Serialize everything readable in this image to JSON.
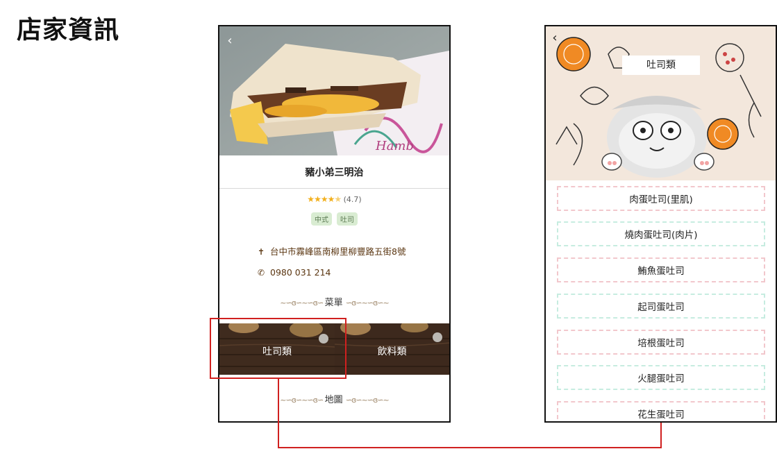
{
  "page": {
    "title": "店家資訊"
  },
  "shop_screen": {
    "back_icon": "chevron-left-icon",
    "shop_name": "豬小弟三明治",
    "rating": {
      "stars": 4.5,
      "max_stars": 5,
      "text": "(4.7)"
    },
    "tags": [
      "中式",
      "吐司"
    ],
    "address": "台中市霧峰區南柳里柳豐路五街8號",
    "address_icon": "signpost-icon",
    "phone": "0980 031 214",
    "phone_icon": "phone-icon",
    "menu_section": "菜單",
    "categories": [
      {
        "label": "吐司類"
      },
      {
        "label": "飲料類"
      }
    ],
    "map_section": "地圖"
  },
  "menu_screen": {
    "back_icon": "chevron-left-icon",
    "banner_title": "吐司類",
    "items": [
      {
        "label": "肉蛋吐司(里肌)"
      },
      {
        "label": "燒肉蛋吐司(肉片)"
      },
      {
        "label": "鮪魚蛋吐司"
      },
      {
        "label": "起司蛋吐司"
      },
      {
        "label": "培根蛋吐司"
      },
      {
        "label": "火腿蛋吐司"
      },
      {
        "label": "花生蛋吐司"
      }
    ]
  },
  "colors": {
    "annotation": "#d0201f",
    "address_text": "#5a3510",
    "tag_bg": "#d9ecd2",
    "star": "#f2b01e",
    "dash_pink": "#f2c7cc",
    "dash_mint": "#c6ece0"
  }
}
